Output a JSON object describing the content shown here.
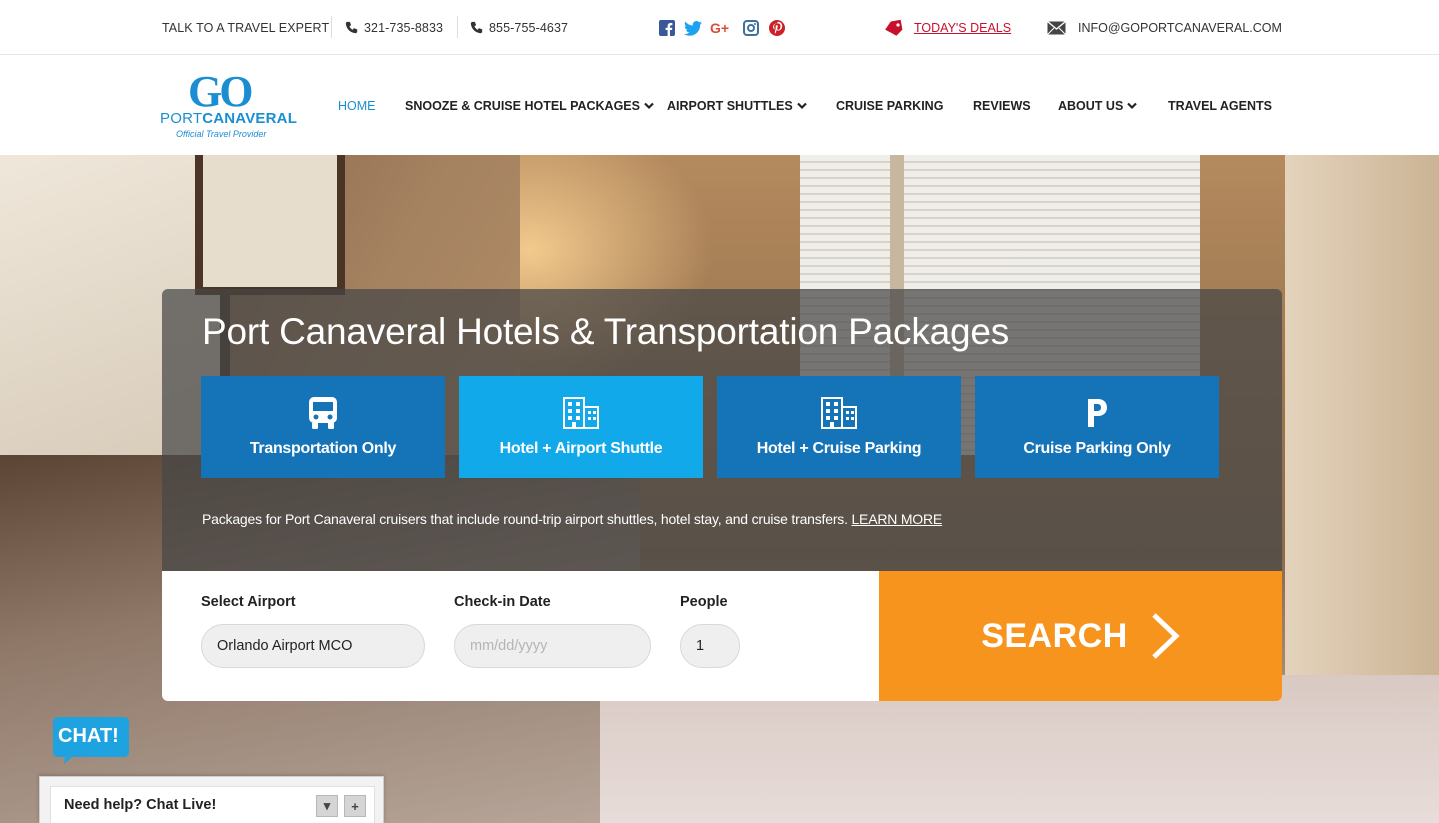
{
  "topbar": {
    "expert_label": "TALK TO A TRAVEL EXPERT",
    "phone1": "321-735-8833",
    "phone2": "855-755-4637",
    "social_icons": [
      "facebook-icon",
      "twitter-icon",
      "google-plus-icon",
      "instagram-icon",
      "pinterest-icon"
    ],
    "deals_label": "TODAY'S DEALS",
    "email": "INFO@GOPORTCANAVERAL.COM"
  },
  "logo": {
    "go": "GO",
    "port": "PORT",
    "canaveral": "CANAVERAL",
    "tagline": "Official Travel Provider"
  },
  "nav": {
    "home": "HOME",
    "snooze": "SNOOZE & CRUISE HOTEL PACKAGES",
    "shuttles": "AIRPORT SHUTTLES",
    "parking": "CRUISE PARKING",
    "reviews": "REVIEWS",
    "about": "ABOUT US",
    "agents": "TRAVEL AGENTS"
  },
  "hero": {
    "title": "Port Canaveral Hotels & Transportation Packages",
    "tabs": [
      {
        "label": "Transportation Only",
        "icon": "bus-icon"
      },
      {
        "label": "Hotel + Airport Shuttle",
        "icon": "building-icon"
      },
      {
        "label": "Hotel + Cruise Parking",
        "icon": "building-icon"
      },
      {
        "label": "Cruise Parking Only",
        "icon": "parking-icon"
      }
    ],
    "description": "Packages for Port Canaveral cruisers that include round-trip airport shuttles, hotel stay, and cruise transfers.",
    "learn_more": "LEARN MORE"
  },
  "form": {
    "airport_label": "Select Airport",
    "airport_value": "Orlando Airport MCO",
    "checkin_label": "Check-in Date",
    "checkin_placeholder": "mm/dd/yyyy",
    "people_label": "People",
    "people_value": "1",
    "search_label": "SEARCH"
  },
  "chat": {
    "bubble_label": "CHAT!",
    "bar_label": "Need help? Chat Live!",
    "minimize_symbol": "▾",
    "expand_symbol": "+"
  },
  "colors": {
    "brand_blue": "#1b8ed1",
    "tab_blue": "#1574b8",
    "tab_active": "#12a9ea",
    "search_orange": "#f7941d",
    "deals_red": "#c8102e"
  }
}
